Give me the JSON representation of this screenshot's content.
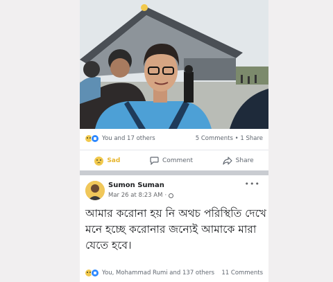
{
  "post1": {
    "reaction_summary": "You and 17 others",
    "counts": "5 Comments • 1 Share"
  },
  "actions": {
    "sad_label": "Sad",
    "comment_label": "Comment",
    "share_label": "Share"
  },
  "post2": {
    "author": "Sumon Suman",
    "date": "Mar 26 at 8:23 AM",
    "text": "আমার করোনা হয় নি অথচ পরিস্থিতি দেখে মনে হচ্ছে করোনার জন্যেই আমাকে মারা যেতে হবে।",
    "reaction_summary": "You, Mohammad Rumi and 137 others",
    "comments": "11 Comments"
  },
  "colors": {
    "sad_accent": "#e7b52d",
    "like_blue": "#2d88ff",
    "text_primary": "#1c1e21",
    "text_secondary": "#65676b"
  },
  "icons": [
    "sad-reaction-icon",
    "like-reaction-icon",
    "comment-icon",
    "share-icon",
    "globe-icon",
    "more-icon"
  ]
}
